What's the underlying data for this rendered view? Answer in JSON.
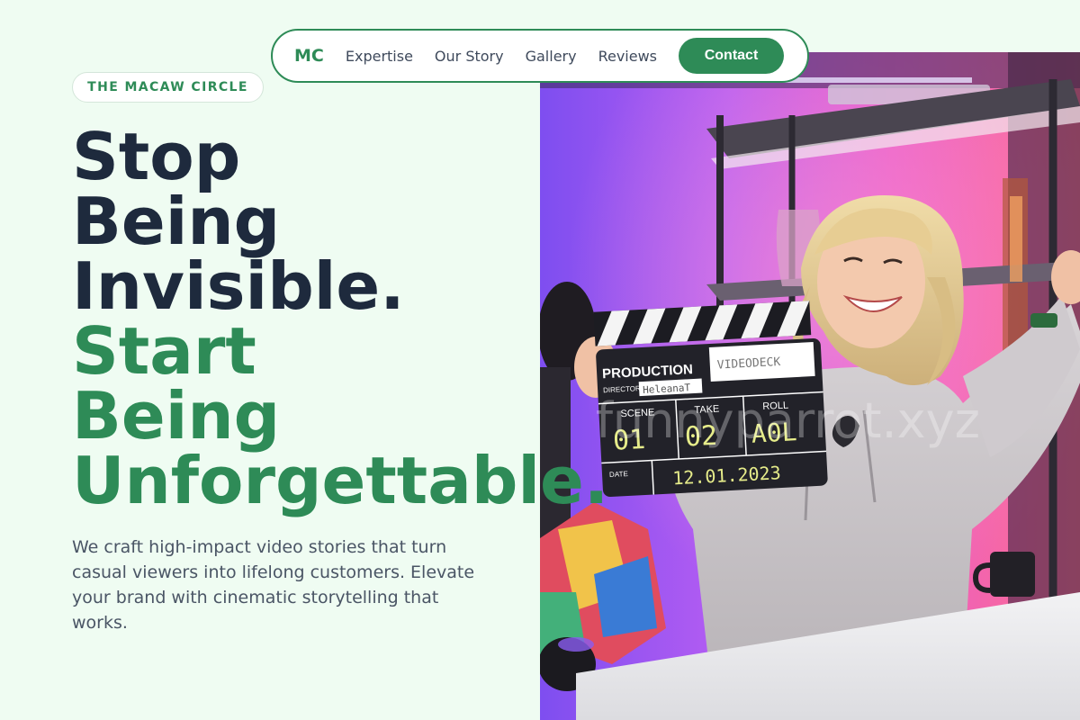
{
  "nav": {
    "logo": "MC",
    "links": [
      "Expertise",
      "Our Story",
      "Gallery",
      "Reviews"
    ],
    "contact": "Contact"
  },
  "badge": "THE MACAW CIRCLE",
  "headline": {
    "line1": "Stop",
    "line2": "Being",
    "line3": "Invisible.",
    "line4": "Start",
    "line5": "Being",
    "line6": "Unforgettable."
  },
  "subtext": "We craft high-impact video stories that turn casual viewers into lifelong customers. Elevate your brand with cinematic storytelling that works.",
  "hero_image": {
    "clapper": {
      "title": "PRODUCTION",
      "production_name": "VIDEODECK",
      "director_label": "DIRECTOR",
      "director": "HeleanaT",
      "scene_label": "SCENE",
      "take_label": "TAKE",
      "roll_label": "ROLL",
      "scene": "01",
      "take": "02",
      "roll": "A0L",
      "date_label": "DATE",
      "date": "12.01.2023"
    },
    "watermark": "funnyparrot.xyz"
  },
  "colors": {
    "accent": "#2e8b57",
    "heading": "#1e2a3d",
    "background": "#effcf2"
  }
}
